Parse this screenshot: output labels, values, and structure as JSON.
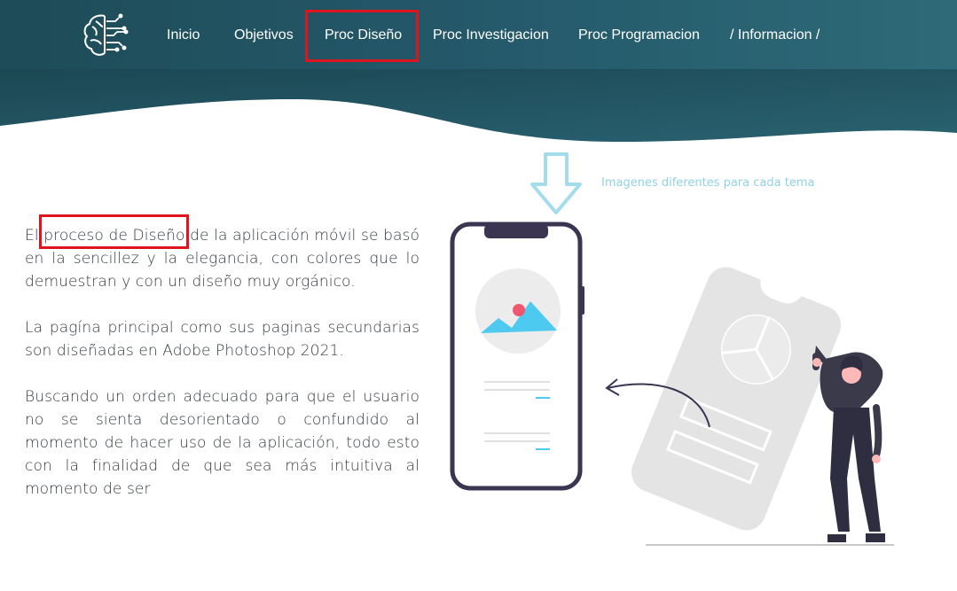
{
  "nav": {
    "items": [
      {
        "label": "Inicio"
      },
      {
        "label": "Objetivos"
      },
      {
        "label": "Proc Diseño"
      },
      {
        "label": "Proc Investigacion"
      },
      {
        "label": "Proc Programacion"
      },
      {
        "label": "/ Informacion /"
      }
    ],
    "active_index": 2
  },
  "logo": {
    "icon": "brain-circuit-icon"
  },
  "content": {
    "paragraph_1": "El proceso de Diseño de la aplicación móvil se basó en la sencillez y la elegancia, con colores que lo demuestran y con un diseño muy orgánico.",
    "paragraph_2": "La pagína principal como sus paginas secundarias son diseñadas en Adobe Photoshop 2021.",
    "paragraph_3": "Buscando un orden adecuado para que el usuario no se sienta desorientado o confundido al momento de hacer uso de la aplicación, todo esto con la finalidad de que sea más intuitiva al momento de ser"
  },
  "annotation": {
    "text": "Imagenes diferentes para cada tema",
    "arrow_icon": "down-arrow-outline-icon"
  },
  "colors": {
    "header_dark": "#1f4f5c",
    "header_light": "#2f6b78",
    "highlight_red": "#e0141e",
    "annotation_blue": "#8fd2e6",
    "phone_frame": "#3b3551",
    "accent_blue": "#4ecaf0",
    "accent_red": "#f0576e"
  }
}
